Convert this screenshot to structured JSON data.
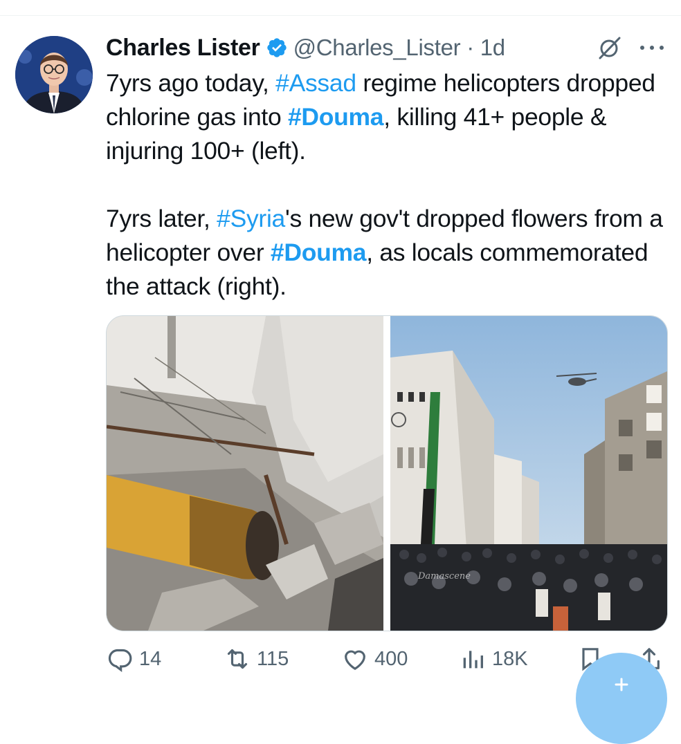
{
  "tweet": {
    "author_name": "Charles Lister",
    "handle_line": "@Charles_Lister · 1d",
    "text_segments": [
      "7yrs ago today, ",
      "#Assad",
      " regime helicopters dropped chlorine gas into ",
      "#Douma",
      ", killing 41+ people & injuring 100+ (left).",
      "7yrs later, ",
      "#Syria",
      "'s new gov't dropped flowers from a helicopter over ",
      "#Douma",
      ", as locals commemorated the attack (right)."
    ],
    "photo_watermark": "Damascene"
  },
  "actions": {
    "replies": "14",
    "reposts": "115",
    "likes": "400",
    "views": "18K"
  },
  "icons": {
    "verified": "verified-badge-icon",
    "grok": "grok-icon",
    "more": "more-options-icon",
    "reply": "reply-icon",
    "repost": "repost-icon",
    "like": "heart-icon",
    "views": "views-chart-icon",
    "bookmark": "bookmark-icon",
    "share": "share-icon",
    "compose": "plus-icon"
  },
  "colors": {
    "accent": "#1d9bf0",
    "text": "#0f1419",
    "muted": "#536471",
    "fab": "#8fcaf6"
  }
}
